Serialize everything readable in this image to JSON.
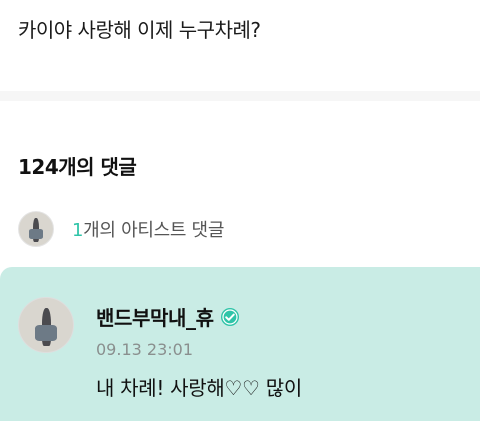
{
  "post": {
    "text": "카이야 사랑해 이제 누구차례?"
  },
  "comments": {
    "total_label": "124개의 댓글",
    "artist_summary": {
      "count": "1",
      "suffix": "개의 아티스트 댓글"
    }
  },
  "artist_comment": {
    "author": "밴드부막내_휴",
    "verified_icon": "verified-check-badge",
    "timestamp": "09.13 23:01",
    "body": "내 차례! 사랑해♡♡ 많이"
  },
  "colors": {
    "accent": "#2fc4a8",
    "artist_highlight_bg": "#c9ece5",
    "muted_text": "#8a8f8e"
  }
}
